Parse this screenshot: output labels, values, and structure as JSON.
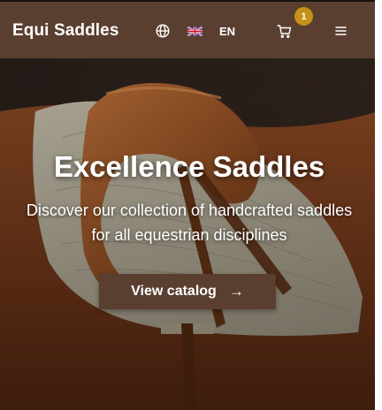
{
  "header": {
    "brand": "Equi Saddles",
    "language": "EN",
    "cart_count": "1",
    "icons": {
      "globe": "globe-icon",
      "flag": "uk-flag-icon",
      "cart": "cart-icon",
      "menu": "hamburger-menu-icon"
    }
  },
  "hero": {
    "title": "Excellence Saddles",
    "subtitle": "Discover our collection of handcrafted saddles for all equestrian disciplines",
    "cta_label": "View catalog",
    "cta_icon": "arrow-right-icon"
  },
  "colors": {
    "header_bg": "#5a3f31",
    "badge": "#c7901a",
    "button_bg": "#5a3f31",
    "text": "#ffffff"
  }
}
